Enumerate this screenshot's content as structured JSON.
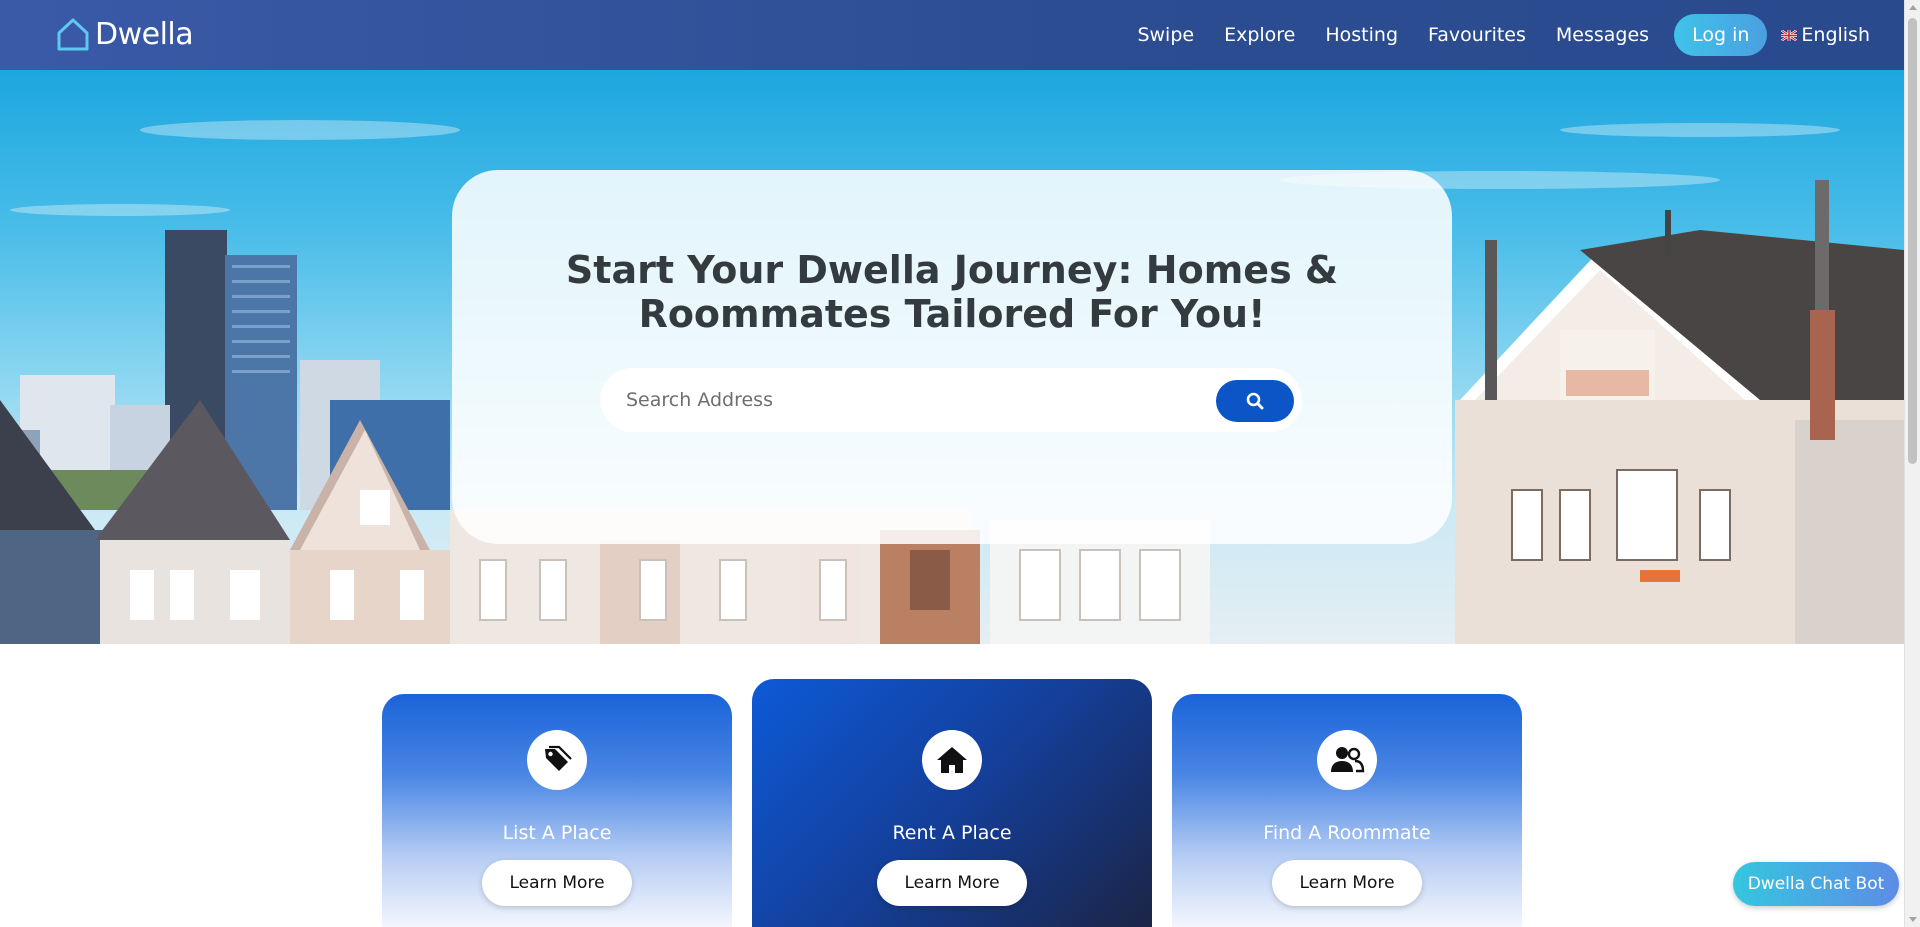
{
  "brand": {
    "name": "Dwella",
    "logo_icon": "house-outline-icon"
  },
  "nav": {
    "links": [
      "Swipe",
      "Explore",
      "Hosting",
      "Favourites",
      "Messages"
    ],
    "login_label": "Log in",
    "language": {
      "label": "English",
      "flag_icon": "uk-flag-icon"
    }
  },
  "hero": {
    "title": "Start Your Dwella Journey: Homes & Roommates Tailored For You!",
    "search": {
      "placeholder": "Search Address",
      "value": "",
      "button_icon": "search-icon"
    }
  },
  "cards": [
    {
      "title": "List A Place",
      "icon": "tags-icon",
      "button_label": "Learn More",
      "style": "light"
    },
    {
      "title": "Rent A Place",
      "icon": "home-icon",
      "button_label": "Learn More",
      "style": "dark"
    },
    {
      "title": "Find A Roommate",
      "icon": "users-icon",
      "button_label": "Learn More",
      "style": "light"
    }
  ],
  "chatbot": {
    "label": "Dwella Chat Bot"
  },
  "colors": {
    "navbar": "#2d4d93",
    "login_button": "#3fc3ea",
    "search_button": "#0b55c6",
    "card_blue": "#1a63d9",
    "card_dark": "#1b2546",
    "chatbot": "#34c6df"
  }
}
